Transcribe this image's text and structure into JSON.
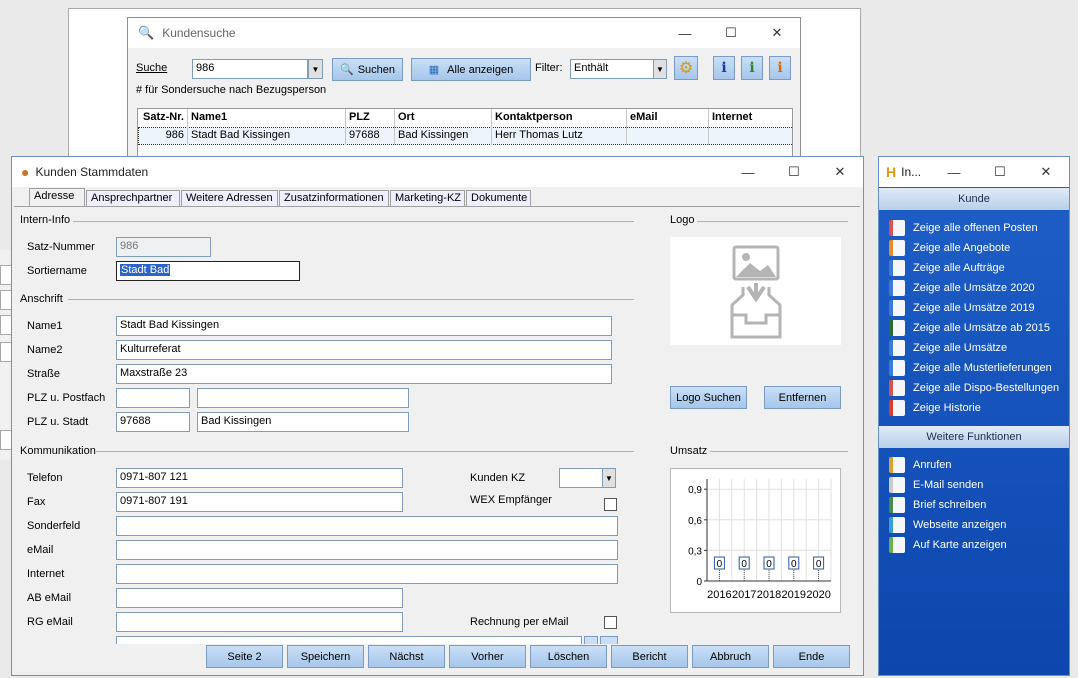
{
  "search_window": {
    "title": "Kundensuche",
    "search_label": "Suche",
    "search_value": "986",
    "search_button": "Suchen",
    "show_all_button": "Alle anzeigen",
    "filter_label": "Filter:",
    "filter_value": "Enthält",
    "hint": "# für Sondersuche nach Bezugsperson",
    "columns": [
      "Satz-Nr.",
      "Name1",
      "PLZ",
      "Ort",
      "Kontaktperson",
      "eMail",
      "Internet"
    ],
    "row": [
      "986",
      "Stadt Bad Kissingen",
      "97688",
      "Bad Kissingen",
      "Herr Thomas Lutz",
      "",
      ""
    ]
  },
  "main_window": {
    "title": "Kunden Stammdaten",
    "tabs": [
      "Adresse",
      "Ansprechpartner",
      "Weitere Adressen",
      "Zusatzinformationen",
      "Marketing-KZ",
      "Dokumente"
    ],
    "sections": {
      "intern": "Intern-Info",
      "anschrift": "Anschrift",
      "kommunikation": "Kommunikation",
      "logo": "Logo",
      "umsatz": "Umsatz"
    },
    "fields": {
      "satz_nummer": {
        "label": "Satz-Nummer",
        "value": "986"
      },
      "sortiername": {
        "label": "Sortiername",
        "value": "Stadt Bad"
      },
      "name1": {
        "label": "Name1",
        "value": "Stadt Bad Kissingen"
      },
      "name2": {
        "label": "Name2",
        "value": "Kulturreferat"
      },
      "strasse": {
        "label": "Straße",
        "value": "Maxstraße 23"
      },
      "plz_postfach": {
        "label": "PLZ u. Postfach",
        "plz": "",
        "postfach": ""
      },
      "plz_stadt": {
        "label": "PLZ u. Stadt",
        "plz": "97688",
        "stadt": "Bad Kissingen"
      },
      "telefon": {
        "label": "Telefon",
        "value": "0971-807 121"
      },
      "fax": {
        "label": "Fax",
        "value": "0971-807 191"
      },
      "sonderfeld": {
        "label": "Sonderfeld",
        "value": ""
      },
      "email": {
        "label": "eMail",
        "value": ""
      },
      "internet": {
        "label": "Internet",
        "value": ""
      },
      "ab_email": {
        "label": "AB eMail",
        "value": ""
      },
      "rg_email": {
        "label": "RG eMail",
        "value": ""
      },
      "kunden_kz": {
        "label": "Kunden KZ",
        "value": ""
      },
      "wex": {
        "label": "WEX Empfänger"
      },
      "rechnung_email": {
        "label": "Rechnung per eMail"
      }
    },
    "logo_buttons": {
      "search": "Logo Suchen",
      "remove": "Entfernen"
    },
    "bottom_buttons": [
      "Seite 2",
      "Speichern",
      "Nächst",
      "Vorher",
      "Löschen",
      "Bericht",
      "Abbruch",
      "Ende"
    ]
  },
  "chart_data": {
    "type": "bar",
    "categories": [
      "2016",
      "2017",
      "2018",
      "2019",
      "2020"
    ],
    "values": [
      0,
      0,
      0,
      0,
      0
    ],
    "data_labels": [
      "0",
      "0",
      "0",
      "0",
      "0"
    ],
    "yticks": [
      "0,9",
      "0,6",
      "0,3",
      "0"
    ],
    "ylim": [
      0,
      1
    ],
    "grid": true
  },
  "side_panel": {
    "title": "In...",
    "kunde_header": "Kunde",
    "kunde_items": [
      {
        "label": "Zeige alle offenen Posten",
        "icon": "open-items-icon",
        "color": "#d9534f"
      },
      {
        "label": "Zeige alle Angebote",
        "icon": "offer-icon",
        "color": "#e88c2a"
      },
      {
        "label": "Zeige alle Aufträge",
        "icon": "order-icon",
        "color": "#3a7bd5"
      },
      {
        "label": "Zeige alle Umsätze 2020",
        "icon": "sales-icon",
        "color": "#3a7bd5"
      },
      {
        "label": "Zeige alle Umsätze 2019",
        "icon": "sales-icon",
        "color": "#3a7bd5"
      },
      {
        "label": "Zeige alle Umsätze ab 2015",
        "icon": "sales-dollar-icon",
        "color": "#2d6a2d"
      },
      {
        "label": "Zeige alle Umsätze",
        "icon": "sales-all-icon",
        "color": "#3a7bd5"
      },
      {
        "label": "Zeige alle Musterlieferungen",
        "icon": "samples-icon",
        "color": "#3a7bd5"
      },
      {
        "label": "Zeige alle Dispo-Bestellungen",
        "icon": "dispo-icon",
        "color": "#d9534f"
      },
      {
        "label": "Zeige Historie",
        "icon": "history-icon",
        "color": "#e03b2a"
      }
    ],
    "functions_header": "Weitere Funktionen",
    "function_items": [
      {
        "label": "Anrufen",
        "icon": "phone-icon",
        "color": "#e0a030"
      },
      {
        "label": "E-Mail senden",
        "icon": "mail-icon",
        "color": "#cccccc"
      },
      {
        "label": "Brief schreiben",
        "icon": "letter-icon",
        "color": "#4a8a4a"
      },
      {
        "label": "Webseite anzeigen",
        "icon": "web-icon",
        "color": "#3aa0d0"
      },
      {
        "label": "Auf Karte anzeigen",
        "icon": "map-icon",
        "color": "#6ab04c"
      }
    ]
  }
}
